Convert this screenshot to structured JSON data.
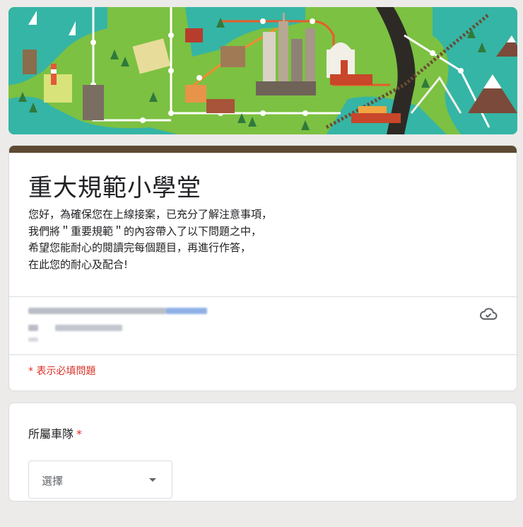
{
  "form": {
    "title": "重大規範小學堂",
    "description": [
      "您好，為確保您在上線接案，已充分了解注意事項，",
      "我們將＂重要規範＂的內容帶入了以下問題之中，",
      "希望您能耐心的閱讀完每個題目，再進行作答，",
      "在此您的耐心及配合!"
    ],
    "required_note": "* 表示必填問題",
    "account_icon": "cloud-check-icon"
  },
  "question": {
    "label": "所屬車隊",
    "required_mark": "*",
    "select_value": "選擇"
  },
  "colors": {
    "accent": "#5c4a32",
    "required": "#d93025",
    "background": "#ecebe9"
  }
}
